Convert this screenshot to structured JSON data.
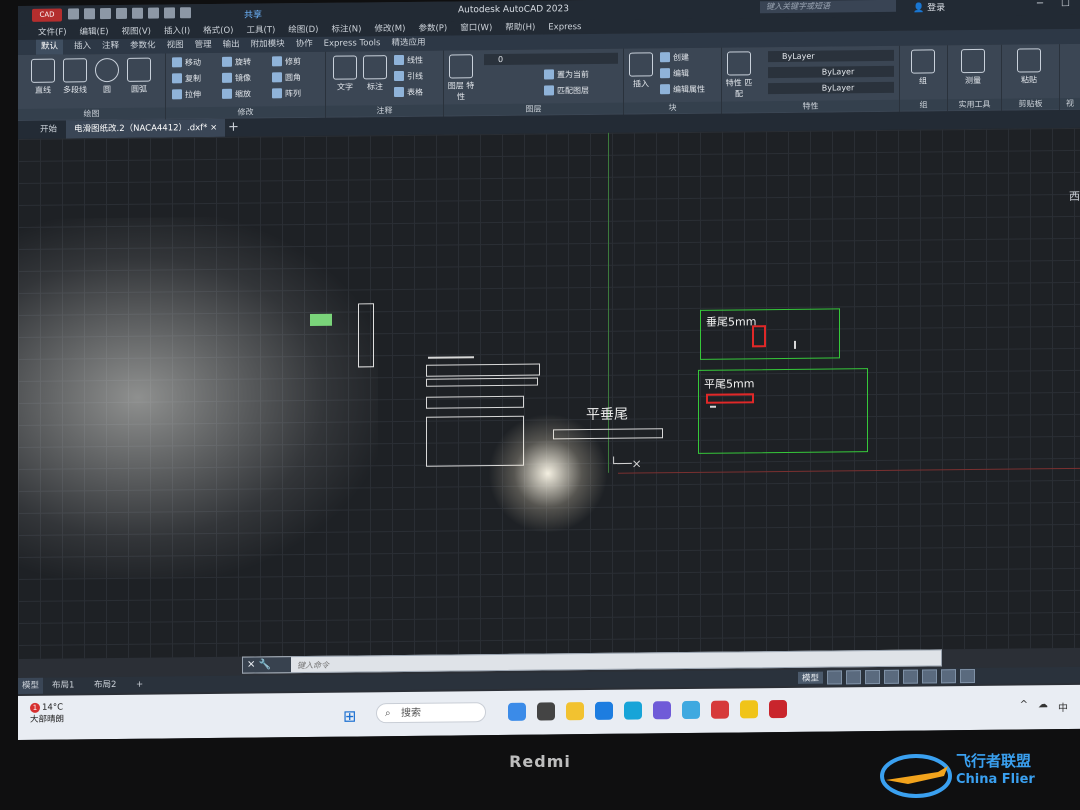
{
  "titlebar": {
    "app_badge": "CAD",
    "share": "共享",
    "title": "Autodesk AutoCAD 2023",
    "search_placeholder": "键入关键字或短语",
    "signin": "登录"
  },
  "menu": [
    "文件(F)",
    "编辑(E)",
    "视图(V)",
    "插入(I)",
    "格式(O)",
    "工具(T)",
    "绘图(D)",
    "标注(N)",
    "修改(M)",
    "参数(P)",
    "窗口(W)",
    "帮助(H)",
    "Express"
  ],
  "ribbon_tabs": [
    "默认",
    "插入",
    "注释",
    "参数化",
    "视图",
    "管理",
    "输出",
    "附加模块",
    "协作",
    "Express Tools",
    "精选应用"
  ],
  "ribbon": {
    "draw": {
      "title": "绘图",
      "line": "直线",
      "polyline": "多段线",
      "circle": "圆",
      "arc": "圆弧"
    },
    "modify": {
      "title": "修改",
      "move": "移动",
      "rotate": "旋转",
      "trim": "修剪",
      "copy": "复制",
      "mirror": "镜像",
      "fillet": "圆角",
      "stretch": "拉伸",
      "scale": "缩放",
      "array": "阵列"
    },
    "annotation": {
      "title": "注释",
      "text": "文字",
      "dimension": "标注",
      "linear": "线性",
      "leader": "引线",
      "table": "表格"
    },
    "layers": {
      "title": "图层",
      "props": "图层\n特性",
      "layer_value": "0",
      "make_current": "置为当前",
      "match": "匹配图层"
    },
    "block": {
      "title": "块",
      "insert": "插入",
      "create": "创建",
      "edit": "编辑",
      "edit_attr": "编辑属性"
    },
    "properties": {
      "title": "特性",
      "match": "特性\n匹配",
      "color": "ByLayer",
      "linetype": "ByLayer",
      "lineweight": "ByLayer"
    },
    "groups": {
      "title": "组",
      "group": "组"
    },
    "utilities": {
      "title": "实用工具",
      "measure": "测量"
    },
    "clipboard": {
      "title": "剪贴板",
      "paste": "粘贴"
    },
    "view": {
      "title": "视"
    }
  },
  "doc_tabs": {
    "start": "开始",
    "file": "电滑图纸改.2（NACA4412）.dxf*",
    "close": "×",
    "add": "+"
  },
  "canvas": {
    "group1_label": "垂尾5mm",
    "group2_label": "平尾5mm",
    "center_label": "平垂尾",
    "viewcube": "西"
  },
  "command_line": {
    "placeholder": "键入命令"
  },
  "layout_tabs": [
    "模型",
    "布局1",
    "布局2",
    "+"
  ],
  "status": {
    "model": "模型"
  },
  "taskbar": {
    "weather_temp": "14°C",
    "weather_desc": "大部晴朗",
    "badge": "1",
    "search": "搜索",
    "ime": "中"
  },
  "device": {
    "brand": "Redmi"
  },
  "watermark": {
    "cn": "飞行者联盟",
    "en": "China Flier"
  }
}
